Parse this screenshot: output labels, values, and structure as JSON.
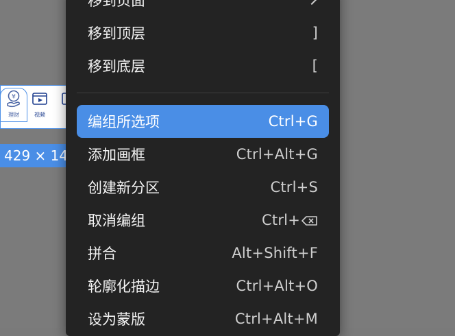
{
  "canvas": {
    "size_label": "429 × 14",
    "icons": [
      {
        "name": "finance-icon",
        "caption": "理财"
      },
      {
        "name": "video-icon",
        "caption": "视频"
      }
    ]
  },
  "menu": {
    "items": [
      {
        "label": "移到页面",
        "shortcut": "",
        "submenu": true
      },
      {
        "label": "移到顶层",
        "shortcut": "]"
      },
      {
        "label": "移到底层",
        "shortcut": "["
      },
      {
        "label": "编组所选项",
        "shortcut": "Ctrl+G",
        "active": true
      },
      {
        "label": "添加画框",
        "shortcut": "Ctrl+Alt+G"
      },
      {
        "label": "创建新分区",
        "shortcut": "Ctrl+S"
      },
      {
        "label": "取消编组",
        "shortcut": "Ctrl+"
      },
      {
        "label": "拼合",
        "shortcut": "Alt+Shift+F"
      },
      {
        "label": "轮廓化描边",
        "shortcut": "Ctrl+Alt+O"
      },
      {
        "label": "设为蒙版",
        "shortcut": "Ctrl+Alt+M"
      }
    ]
  },
  "colors": {
    "accent": "#4a8ee6",
    "menu_bg": "#232323",
    "canvas_bg": "#7b7b7b"
  }
}
